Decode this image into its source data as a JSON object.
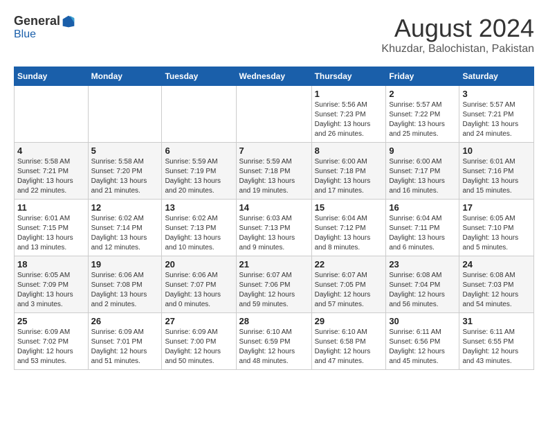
{
  "header": {
    "logo_general": "General",
    "logo_blue": "Blue",
    "month_year": "August 2024",
    "location": "Khuzdar, Balochistan, Pakistan"
  },
  "days_of_week": [
    "Sunday",
    "Monday",
    "Tuesday",
    "Wednesday",
    "Thursday",
    "Friday",
    "Saturday"
  ],
  "weeks": [
    [
      {
        "day": "",
        "info": ""
      },
      {
        "day": "",
        "info": ""
      },
      {
        "day": "",
        "info": ""
      },
      {
        "day": "",
        "info": ""
      },
      {
        "day": "1",
        "info": "Sunrise: 5:56 AM\nSunset: 7:23 PM\nDaylight: 13 hours\nand 26 minutes."
      },
      {
        "day": "2",
        "info": "Sunrise: 5:57 AM\nSunset: 7:22 PM\nDaylight: 13 hours\nand 25 minutes."
      },
      {
        "day": "3",
        "info": "Sunrise: 5:57 AM\nSunset: 7:21 PM\nDaylight: 13 hours\nand 24 minutes."
      }
    ],
    [
      {
        "day": "4",
        "info": "Sunrise: 5:58 AM\nSunset: 7:21 PM\nDaylight: 13 hours\nand 22 minutes."
      },
      {
        "day": "5",
        "info": "Sunrise: 5:58 AM\nSunset: 7:20 PM\nDaylight: 13 hours\nand 21 minutes."
      },
      {
        "day": "6",
        "info": "Sunrise: 5:59 AM\nSunset: 7:19 PM\nDaylight: 13 hours\nand 20 minutes."
      },
      {
        "day": "7",
        "info": "Sunrise: 5:59 AM\nSunset: 7:18 PM\nDaylight: 13 hours\nand 19 minutes."
      },
      {
        "day": "8",
        "info": "Sunrise: 6:00 AM\nSunset: 7:18 PM\nDaylight: 13 hours\nand 17 minutes."
      },
      {
        "day": "9",
        "info": "Sunrise: 6:00 AM\nSunset: 7:17 PM\nDaylight: 13 hours\nand 16 minutes."
      },
      {
        "day": "10",
        "info": "Sunrise: 6:01 AM\nSunset: 7:16 PM\nDaylight: 13 hours\nand 15 minutes."
      }
    ],
    [
      {
        "day": "11",
        "info": "Sunrise: 6:01 AM\nSunset: 7:15 PM\nDaylight: 13 hours\nand 13 minutes."
      },
      {
        "day": "12",
        "info": "Sunrise: 6:02 AM\nSunset: 7:14 PM\nDaylight: 13 hours\nand 12 minutes."
      },
      {
        "day": "13",
        "info": "Sunrise: 6:02 AM\nSunset: 7:13 PM\nDaylight: 13 hours\nand 10 minutes."
      },
      {
        "day": "14",
        "info": "Sunrise: 6:03 AM\nSunset: 7:13 PM\nDaylight: 13 hours\nand 9 minutes."
      },
      {
        "day": "15",
        "info": "Sunrise: 6:04 AM\nSunset: 7:12 PM\nDaylight: 13 hours\nand 8 minutes."
      },
      {
        "day": "16",
        "info": "Sunrise: 6:04 AM\nSunset: 7:11 PM\nDaylight: 13 hours\nand 6 minutes."
      },
      {
        "day": "17",
        "info": "Sunrise: 6:05 AM\nSunset: 7:10 PM\nDaylight: 13 hours\nand 5 minutes."
      }
    ],
    [
      {
        "day": "18",
        "info": "Sunrise: 6:05 AM\nSunset: 7:09 PM\nDaylight: 13 hours\nand 3 minutes."
      },
      {
        "day": "19",
        "info": "Sunrise: 6:06 AM\nSunset: 7:08 PM\nDaylight: 13 hours\nand 2 minutes."
      },
      {
        "day": "20",
        "info": "Sunrise: 6:06 AM\nSunset: 7:07 PM\nDaylight: 13 hours\nand 0 minutes."
      },
      {
        "day": "21",
        "info": "Sunrise: 6:07 AM\nSunset: 7:06 PM\nDaylight: 12 hours\nand 59 minutes."
      },
      {
        "day": "22",
        "info": "Sunrise: 6:07 AM\nSunset: 7:05 PM\nDaylight: 12 hours\nand 57 minutes."
      },
      {
        "day": "23",
        "info": "Sunrise: 6:08 AM\nSunset: 7:04 PM\nDaylight: 12 hours\nand 56 minutes."
      },
      {
        "day": "24",
        "info": "Sunrise: 6:08 AM\nSunset: 7:03 PM\nDaylight: 12 hours\nand 54 minutes."
      }
    ],
    [
      {
        "day": "25",
        "info": "Sunrise: 6:09 AM\nSunset: 7:02 PM\nDaylight: 12 hours\nand 53 minutes."
      },
      {
        "day": "26",
        "info": "Sunrise: 6:09 AM\nSunset: 7:01 PM\nDaylight: 12 hours\nand 51 minutes."
      },
      {
        "day": "27",
        "info": "Sunrise: 6:09 AM\nSunset: 7:00 PM\nDaylight: 12 hours\nand 50 minutes."
      },
      {
        "day": "28",
        "info": "Sunrise: 6:10 AM\nSunset: 6:59 PM\nDaylight: 12 hours\nand 48 minutes."
      },
      {
        "day": "29",
        "info": "Sunrise: 6:10 AM\nSunset: 6:58 PM\nDaylight: 12 hours\nand 47 minutes."
      },
      {
        "day": "30",
        "info": "Sunrise: 6:11 AM\nSunset: 6:56 PM\nDaylight: 12 hours\nand 45 minutes."
      },
      {
        "day": "31",
        "info": "Sunrise: 6:11 AM\nSunset: 6:55 PM\nDaylight: 12 hours\nand 43 minutes."
      }
    ]
  ]
}
